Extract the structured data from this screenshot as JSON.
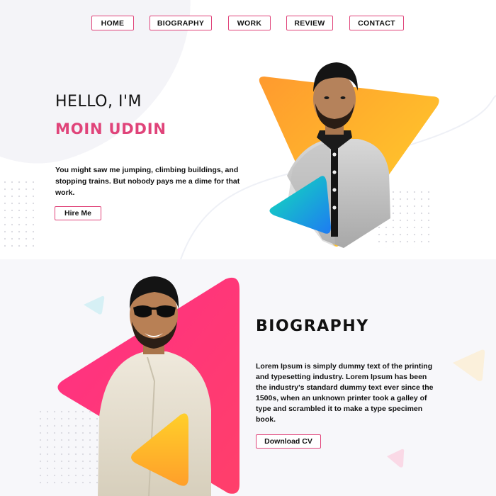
{
  "nav": {
    "items": [
      {
        "label": "HOME"
      },
      {
        "label": "BIOGRAPHY"
      },
      {
        "label": "WORK"
      },
      {
        "label": "REVIEW"
      },
      {
        "label": "CONTACT"
      }
    ]
  },
  "hero": {
    "greeting": "HELLO, I'M",
    "name": "MOIN UDDIN",
    "intro": "You might saw me jumping, climbing buildings, and stopping trains. But nobody pays me a dime for that work.",
    "hire_label": "Hire Me"
  },
  "biography": {
    "title": "BIOGRAPHY",
    "text": "Lorem Ipsum is simply dummy text of the printing and typesetting industry. Lorem Ipsum has been the industry's standard dummy text ever since the 1500s, when an unknown printer took a galley of type and scrambled it to make a type specimen book.",
    "cv_label": "Download CV"
  },
  "colors": {
    "accent": "#e0447a",
    "hero_triangle": [
      "#ff9a2e",
      "#ffd32a"
    ],
    "hero_small_triangle": [
      "#12d9c0",
      "#1e7bf2"
    ],
    "bio_triangle": [
      "#ff2d7a",
      "#ff6a3d"
    ],
    "bio_small_triangle": [
      "#ffd32a",
      "#ff9a2e"
    ]
  }
}
